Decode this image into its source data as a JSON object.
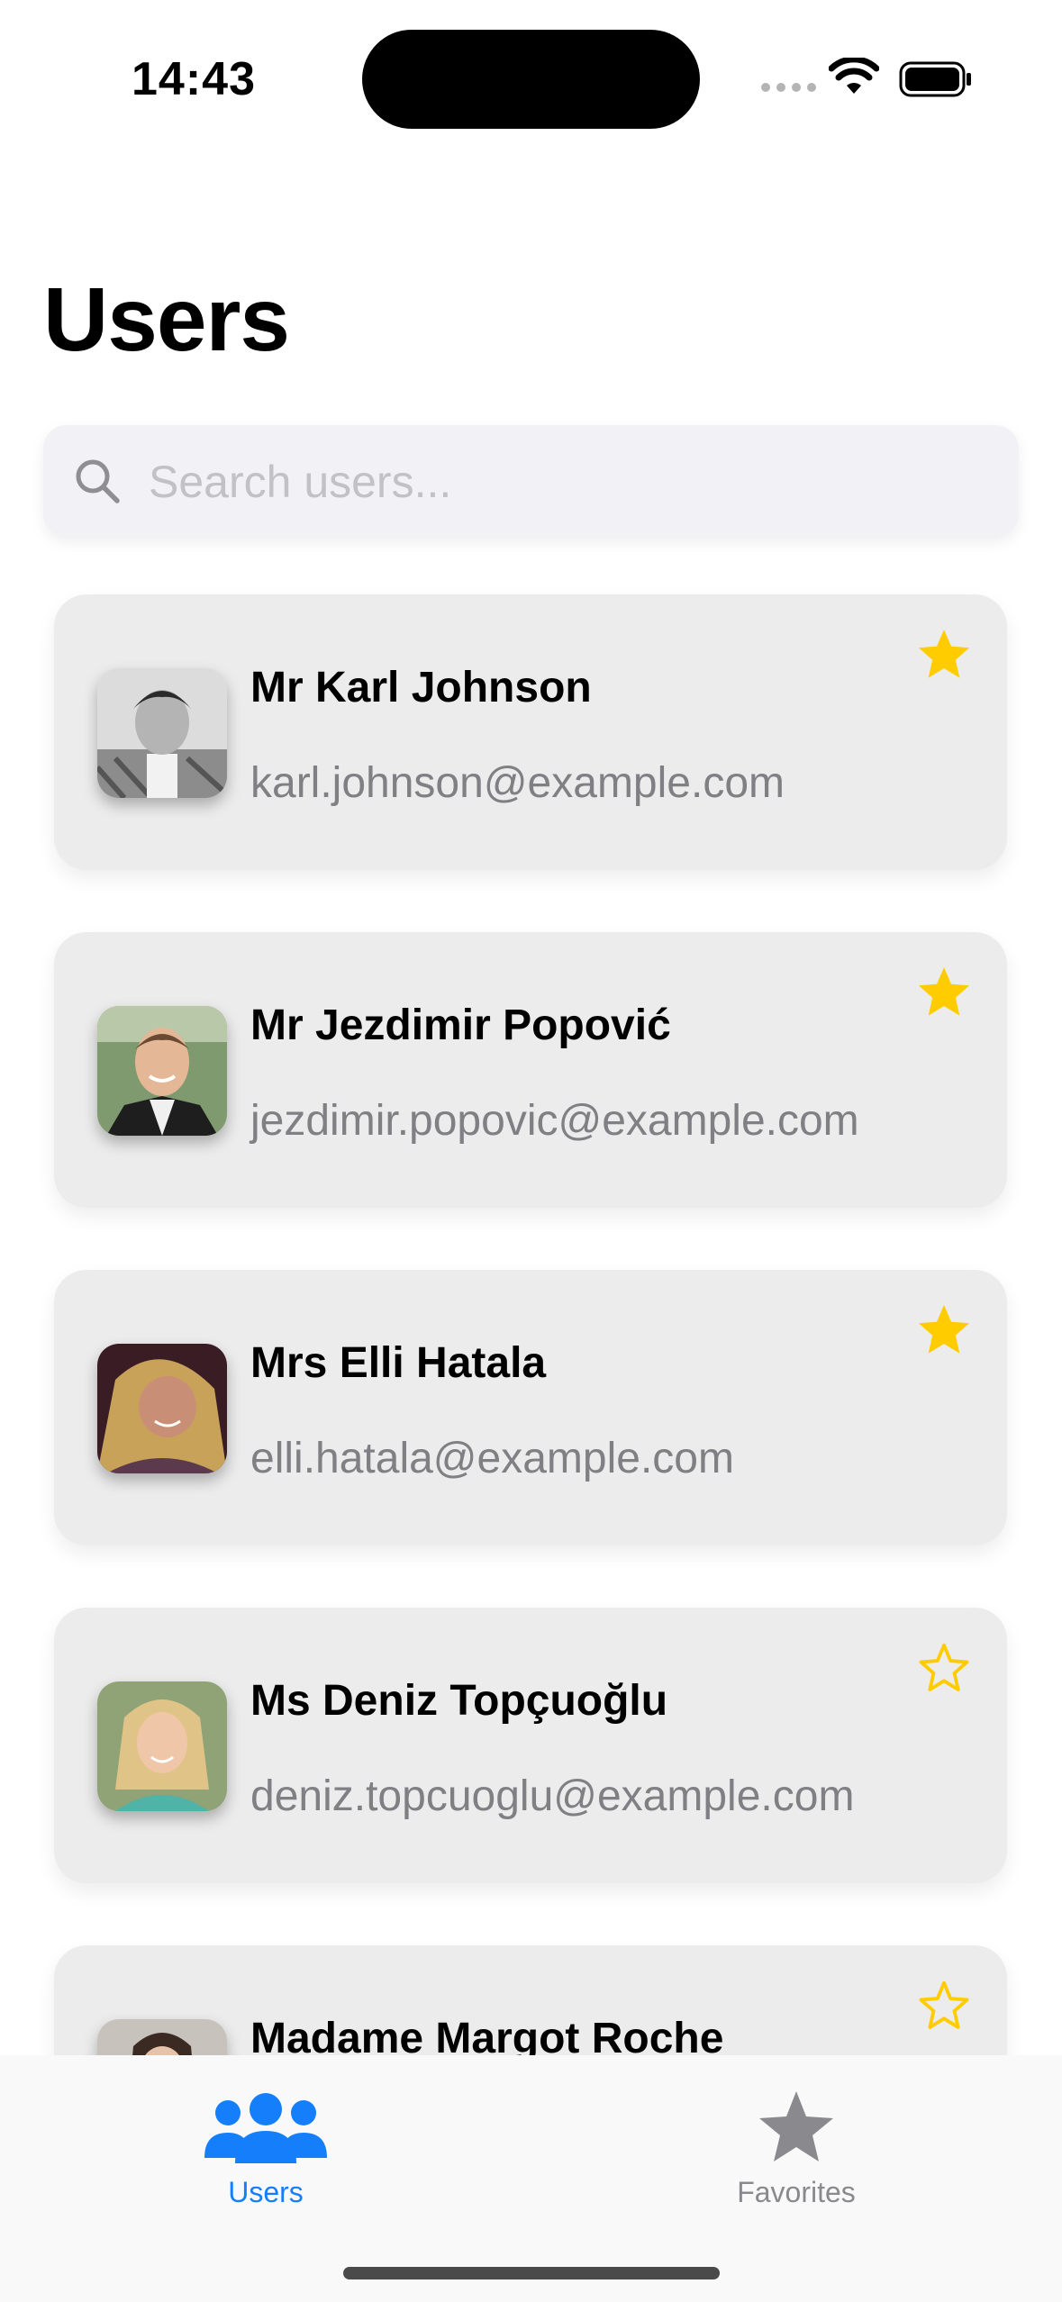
{
  "status_bar": {
    "time": "14:43"
  },
  "header": {
    "title": "Users"
  },
  "search": {
    "placeholder": "Search users...",
    "value": ""
  },
  "users": [
    {
      "name": "Mr Karl Johnson",
      "email": "karl.johnson@example.com",
      "favorite": true
    },
    {
      "name": "Mr Jezdimir Popović",
      "email": "jezdimir.popovic@example.com",
      "favorite": true
    },
    {
      "name": "Mrs Elli Hatala",
      "email": "elli.hatala@example.com",
      "favorite": true
    },
    {
      "name": "Ms Deniz Topçuoğlu",
      "email": "deniz.topcuoglu@example.com",
      "favorite": false
    },
    {
      "name": "Madame Margot Roche",
      "email": "",
      "favorite": false
    }
  ],
  "tab_bar": {
    "tabs": [
      {
        "label": "Users",
        "icon": "people-icon",
        "selected": true
      },
      {
        "label": "Favorites",
        "icon": "star-icon",
        "selected": false
      }
    ]
  },
  "colors": {
    "accent": "#157EFB",
    "star": "#FFCC00",
    "inactive_tab": "#8A8A8E",
    "card_background": "#ECECEC",
    "email_text": "#7F7F84"
  }
}
